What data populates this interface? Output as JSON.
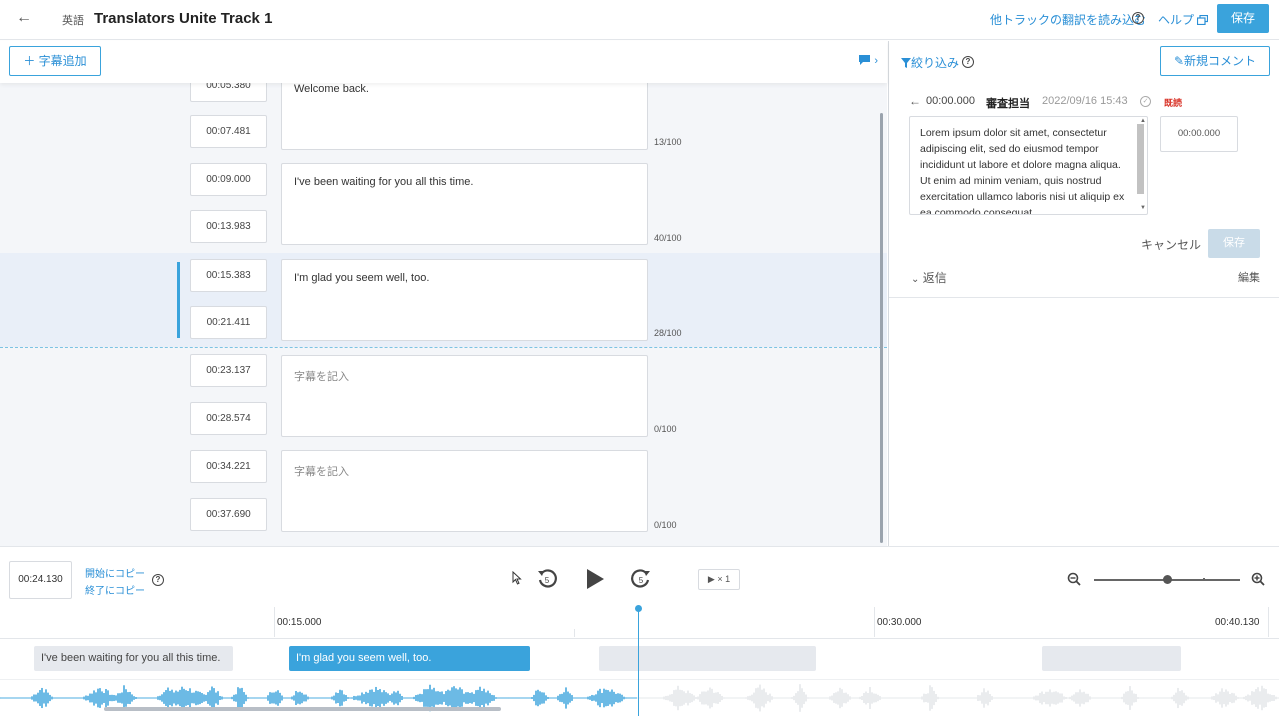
{
  "header": {
    "language": "英語",
    "title": "Translators Unite Track 1",
    "load_other_tracks": "他トラックの翻訳を読み込む",
    "help": "ヘルプ",
    "save": "保存"
  },
  "subtitles_panel": {
    "add_button": "字幕追加",
    "rows": [
      {
        "start": "00:05.380",
        "end": "00:07.481",
        "text": "Welcome back.",
        "count": "13/100"
      },
      {
        "start": "00:09.000",
        "end": "00:13.983",
        "text": "I've been waiting for you all this time.",
        "count": "40/100"
      },
      {
        "start": "00:15.383",
        "end": "00:21.411",
        "text": "I'm glad you seem well, too.",
        "count": "28/100"
      },
      {
        "start": "00:23.137",
        "end": "00:28.574",
        "text": "",
        "placeholder": "字幕を記入",
        "count": "0/100"
      },
      {
        "start": "00:34.221",
        "end": "00:37.690",
        "text": "",
        "placeholder": "字幕を記入",
        "count": "0/100"
      }
    ]
  },
  "comments_panel": {
    "filter": "絞り込み",
    "new_comment": "新規コメント",
    "comment": {
      "time": "00:00.000",
      "author": "審査担当",
      "date": "2022/09/16 15:43",
      "badge": "既読",
      "body": "Lorem ipsum dolor sit amet, consectetur adipiscing elit, sed do eiusmod tempor incididunt ut labore et dolore magna aliqua. Ut enim ad minim veniam, quis nostrud exercitation ullamco laboris nisi ut aliquip ex ea commodo consequat.",
      "time_input": "00:00.000",
      "cancel": "キャンセル",
      "save": "保存",
      "reply": "返信",
      "edit": "編集"
    }
  },
  "player": {
    "current_time": "00:24.130",
    "copy_to_start": "開始にコピー",
    "copy_to_end": "終了にコピー",
    "skip_seconds": "5",
    "speed": "× 1",
    "zoom_level": 0.5,
    "ruler": [
      "00:15.000",
      "00:30.000",
      "00:40.130"
    ],
    "timeline_segments": [
      {
        "text": "I've been waiting for you all this time.",
        "state": "inactive"
      },
      {
        "text": "I'm glad you seem well, too.",
        "state": "active"
      },
      {
        "text": "",
        "state": "inactive"
      },
      {
        "text": "",
        "state": "inactive"
      }
    ]
  },
  "colors": {
    "accent": "#3aa3dc",
    "badge": "#d9362b"
  }
}
